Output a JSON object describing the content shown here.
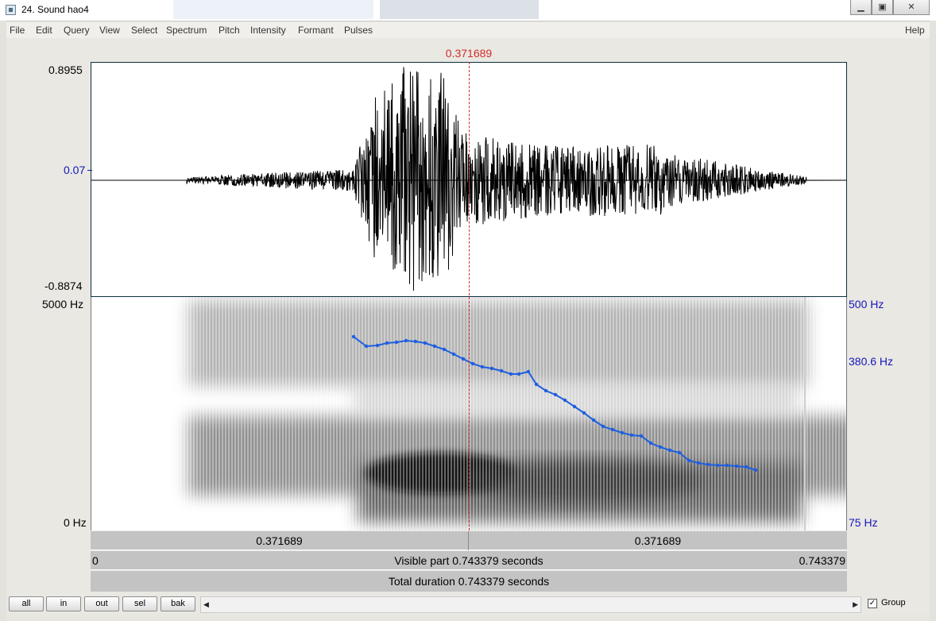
{
  "window": {
    "title": "24. Sound hao4"
  },
  "menu": [
    "File",
    "Edit",
    "Query",
    "View",
    "Select",
    "Spectrum",
    "Pitch",
    "Intensity",
    "Formant",
    "Pulses"
  ],
  "menu_help": "Help",
  "cursor": {
    "time_label": "0.371689"
  },
  "waveform": {
    "ymax_label": "0.8955",
    "ymid_label": "0.07",
    "ymin_label": "-0.8874"
  },
  "spectrogram": {
    "top_label": "5000 Hz",
    "bottom_label": "0 Hz",
    "pitch_top_label": "500 Hz",
    "pitch_cursor_label": "380.6 Hz",
    "pitch_bottom_label": "75 Hz"
  },
  "bars": {
    "left_part": "0.371689",
    "right_part": "0.371689",
    "visible_start": "0",
    "visible_text": "Visible part 0.743379 seconds",
    "visible_end": "0.743379",
    "total_text": "Total duration 0.743379 seconds"
  },
  "buttons": [
    "all",
    "in",
    "out",
    "sel",
    "bak"
  ],
  "group": {
    "label": "Group",
    "checked": "✓"
  },
  "colors": {
    "cursor": "#d42b2b",
    "pitch": "#1e5fe0",
    "axis_blue": "#1515b8"
  }
}
